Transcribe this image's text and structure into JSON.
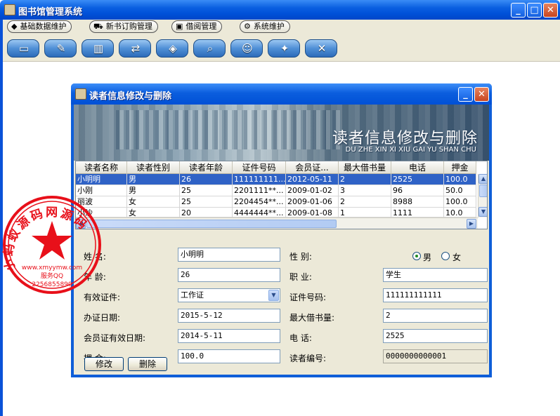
{
  "app": {
    "title": "图书馆管理系统"
  },
  "menu": [
    {
      "label": "基础数据维护",
      "icon": "cube-icon",
      "glyph": "◆"
    },
    {
      "label": "新书订购管理",
      "icon": "cart-icon",
      "glyph": "⛟"
    },
    {
      "label": "借阅管理",
      "icon": "book-lock-icon",
      "glyph": "▣"
    },
    {
      "label": "系统维护",
      "icon": "gear-icon",
      "glyph": "⚙"
    }
  ],
  "toolbar": [
    {
      "name": "book-icon",
      "glyph": "▭"
    },
    {
      "name": "edit-book-icon",
      "glyph": "✎"
    },
    {
      "name": "books-icon",
      "glyph": "▥"
    },
    {
      "name": "return-book-icon",
      "glyph": "⇄"
    },
    {
      "name": "order-book-icon",
      "glyph": "◈"
    },
    {
      "name": "search-icon",
      "glyph": "⌕"
    },
    {
      "name": "reader-icon",
      "glyph": "☺"
    },
    {
      "name": "password-icon",
      "glyph": "✦"
    },
    {
      "name": "exit-icon",
      "glyph": "✕"
    }
  ],
  "dialog": {
    "title": "读者信息修改与删除",
    "banner_title": "读者信息修改与删除",
    "banner_subtitle": "DU ZHE  XIN XI XIU GAI YU SHAN CHU"
  },
  "table": {
    "columns": [
      "读者名称",
      "读者性别",
      "读者年龄",
      "证件号码",
      "会员证...",
      "最大借书量",
      "电话",
      "押金"
    ],
    "rows": [
      [
        "小明明",
        "男",
        "26",
        "111111111...",
        "2012-05-11",
        "2",
        "2525",
        "100.0"
      ],
      [
        "小刚",
        "男",
        "25",
        "2201111**...",
        "2009-01-02",
        "3",
        "96",
        "50.0"
      ],
      [
        "丽波",
        "女",
        "25",
        "2204454**...",
        "2009-01-06",
        "2",
        "8988",
        "100.0"
      ],
      [
        "小沙",
        "女",
        "20",
        "4444444**...",
        "2009-01-08",
        "1",
        "1111",
        "10.0"
      ]
    ]
  },
  "form": {
    "name_label": "姓      名:",
    "name_value": "小明明",
    "gender_label": "性      别:",
    "gender_male": "男",
    "gender_female": "女",
    "age_label": "年      龄:",
    "age_value": "26",
    "job_label": "职      业:",
    "job_value": "学生",
    "cert_label": "有效证件:",
    "cert_value": "工作证",
    "certno_label": "证件号码:",
    "certno_value": "111111111111",
    "issue_label": "办证日期:",
    "issue_value": "2015-5-12",
    "maxbooks_label": "最大借书量:",
    "maxbooks_value": "2",
    "expire_label": "会员证有效日期:",
    "expire_value": "2014-5-11",
    "phone_label": "电      话:",
    "phone_value": "2525",
    "deposit_label": "押      金:",
    "deposit_value": "100.0",
    "readerno_label": "读者编号:",
    "readerno_value": "0000000000001"
  },
  "buttons": {
    "modify": "修改",
    "delete": "删除"
  },
  "stamp": {
    "ring_text": "小蚂蚁源码网源码",
    "site": "www.xmyymw.com",
    "service": "服务QQ",
    "qq": "2256855890"
  }
}
